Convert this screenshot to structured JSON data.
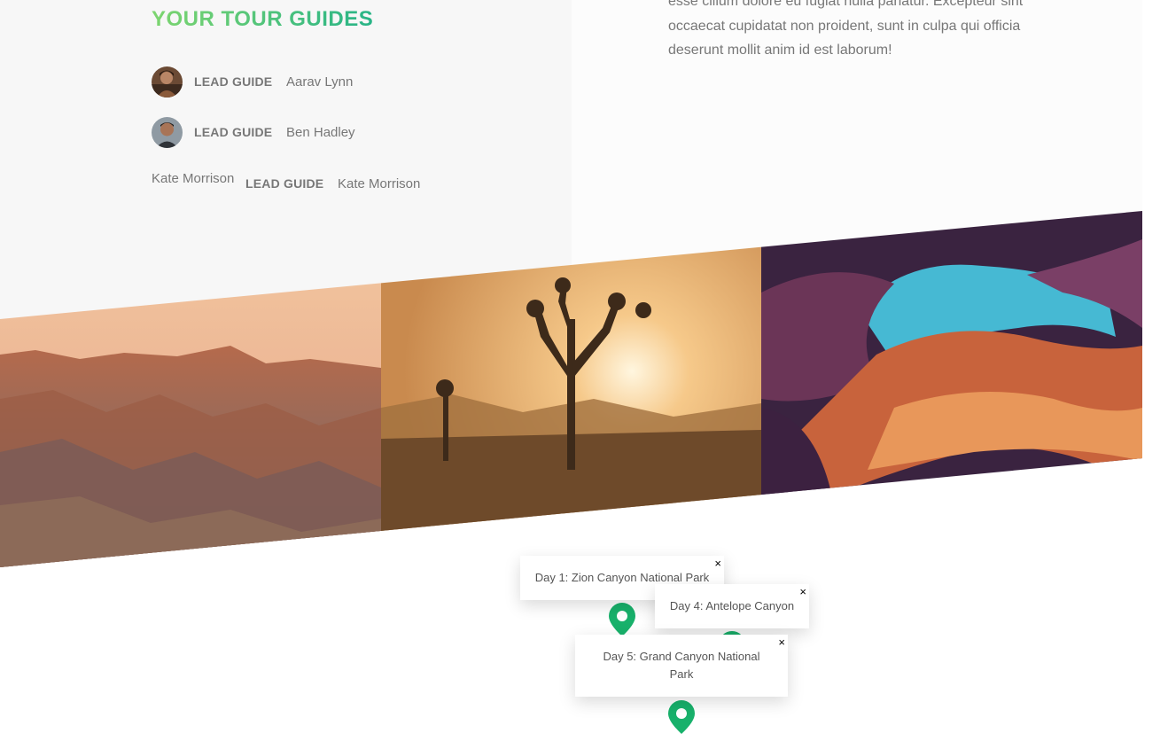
{
  "guides": {
    "title": "YOUR TOUR GUIDES",
    "items": [
      {
        "role": "LEAD GUIDE",
        "name": "Aarav Lynn"
      },
      {
        "role": "LEAD GUIDE",
        "name": "Ben Hadley"
      },
      {
        "alt_text": "Kate Morrison",
        "role": "LEAD GUIDE",
        "name": "Kate Morrison"
      }
    ]
  },
  "description": {
    "text": "esse cillum dolore eu fugiat nulla pariatur. Excepteur sint occaecat cupidatat non proident, sunt in culpa qui officia deserunt mollit anim id est laborum!"
  },
  "pictures": [
    {
      "icon": "grand-canyon-photo"
    },
    {
      "icon": "joshua-tree-photo"
    },
    {
      "icon": "antelope-canyon-photo"
    }
  ],
  "map": {
    "popups": [
      {
        "label": "Day 1: Zion Canyon National Park",
        "close": "×"
      },
      {
        "label": "Day 4: Antelope Canyon",
        "close": "×"
      },
      {
        "label": "Day 5: Grand Canyon National Park",
        "close": "×"
      }
    ]
  },
  "colors": {
    "accent_light": "#7dd56f",
    "accent_dark": "#28b487",
    "marker": "#18b16b",
    "text": "#777777"
  }
}
